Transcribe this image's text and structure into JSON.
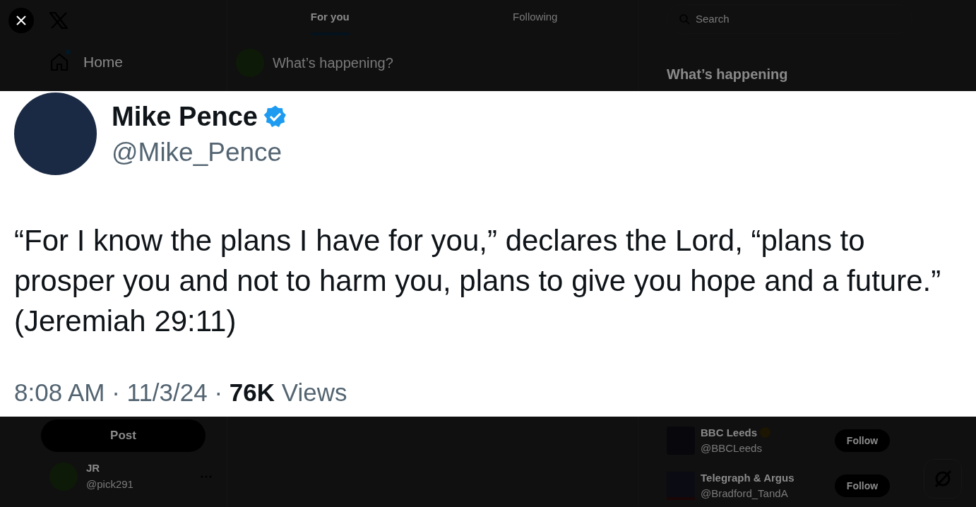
{
  "tabs": [
    {
      "label": "For you",
      "selected": true
    },
    {
      "label": "Following",
      "selected": false
    }
  ],
  "nav": {
    "items": [
      {
        "label": "Home",
        "unread": true
      }
    ],
    "post_button": "Post"
  },
  "account": {
    "name": "JR",
    "handle": "@pick291"
  },
  "composer": {
    "placeholder": "What’s happening?"
  },
  "search": {
    "placeholder": "Search"
  },
  "trends": {
    "title": "What’s happening"
  },
  "who_to_follow": [
    {
      "name": "BBC Leeds",
      "verified": true,
      "handle": "@BBCLeeds",
      "button": "Follow",
      "kind": "bbc"
    },
    {
      "name": "Telegraph & Argus",
      "verified": false,
      "handle": "@Bradford_TandA",
      "button": "Follow",
      "kind": "ta"
    }
  ],
  "tweet": {
    "name": "Mike Pence",
    "verified": true,
    "handle": "@Mike_Pence",
    "text": "“For I know the plans I have for you,” declares the Lord, “plans to prosper you and not to harm you, plans to give you hope and a future.” (Jeremiah 29:11)",
    "meta": "8:08 AM · 11/3/24 · **76K** Views"
  }
}
